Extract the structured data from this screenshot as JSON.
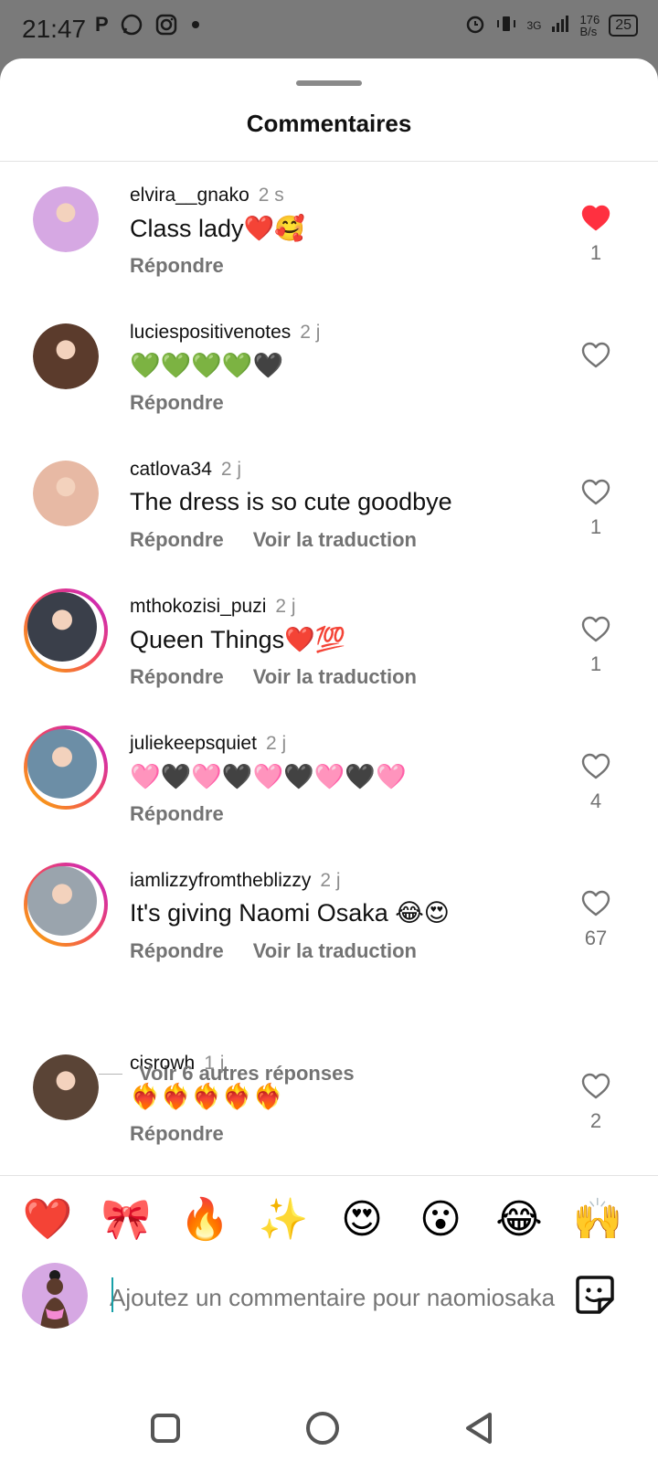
{
  "status": {
    "time": "21:47",
    "network": "3G",
    "speed_value": "176",
    "speed_unit": "B/s",
    "battery": "25"
  },
  "sheet": {
    "title": "Commentaires"
  },
  "comments": [
    {
      "user": "elvira__gnako",
      "time": "2 s",
      "text": "Class lady❤️🥰",
      "likes": "1",
      "liked": true,
      "has_translation": false,
      "avatar_color": "#d6a8e3",
      "ring": false
    },
    {
      "user": "luciespositivenotes",
      "time": "2 j",
      "text": "💚💚💚💚🖤",
      "likes": "",
      "liked": false,
      "has_translation": false,
      "avatar_color": "#5b3b2c",
      "ring": false
    },
    {
      "user": "catlova34",
      "time": "2 j",
      "text": "The dress is so cute goodbye",
      "likes": "1",
      "liked": false,
      "has_translation": true,
      "avatar_color": "#e7b9a4",
      "ring": false
    },
    {
      "user": "mthokozisi_puzi",
      "time": "2 j",
      "text": "Queen Things❤️💯",
      "likes": "1",
      "liked": false,
      "has_translation": true,
      "avatar_color": "#3a3f4a",
      "ring": true
    },
    {
      "user": "juliekeepsquiet",
      "time": "2 j",
      "text": "🩷🖤🩷🖤🩷🖤🩷🖤🩷",
      "likes": "4",
      "liked": false,
      "has_translation": false,
      "avatar_color": "#6c8ea6",
      "ring": true
    },
    {
      "user": "iamlizzyfromtheblizzy",
      "time": "2 j",
      "text": "It's giving Naomi Osaka 😂😍",
      "likes": "67",
      "liked": false,
      "has_translation": true,
      "avatar_color": "#9aa4ad",
      "ring": true
    },
    {
      "user": "cisrowh",
      "time": "1 j",
      "text": "❤️‍🔥❤️‍🔥❤️‍🔥❤️‍🔥❤️‍🔥",
      "likes": "2",
      "liked": false,
      "has_translation": false,
      "avatar_color": "#5a4436",
      "ring": false
    }
  ],
  "labels": {
    "reply": "Répondre",
    "translate": "Voir la traduction",
    "more_replies": "Voir 6 autres réponses"
  },
  "reactions": [
    "❤️",
    "🎀",
    "🔥",
    "✨",
    "😍",
    "😮",
    "😂",
    "🙌"
  ],
  "composer": {
    "placeholder": "Ajoutez un commentaire pour naomiosaka…"
  },
  "colors": {
    "liked_heart": "#ff3040",
    "ring_gradient": [
      "#f9b400",
      "#f24a5d",
      "#c21fd1"
    ],
    "cursor": "#18a0a8"
  },
  "icons": {
    "status_left": [
      "p-icon",
      "whatsapp-icon",
      "instagram-icon",
      "dot-icon"
    ],
    "status_right": [
      "alarm-icon",
      "vibrate-icon",
      "signal-icon",
      "battery-icon"
    ],
    "nav": [
      "recents-square-icon",
      "home-circle-icon",
      "back-triangle-icon"
    ]
  }
}
